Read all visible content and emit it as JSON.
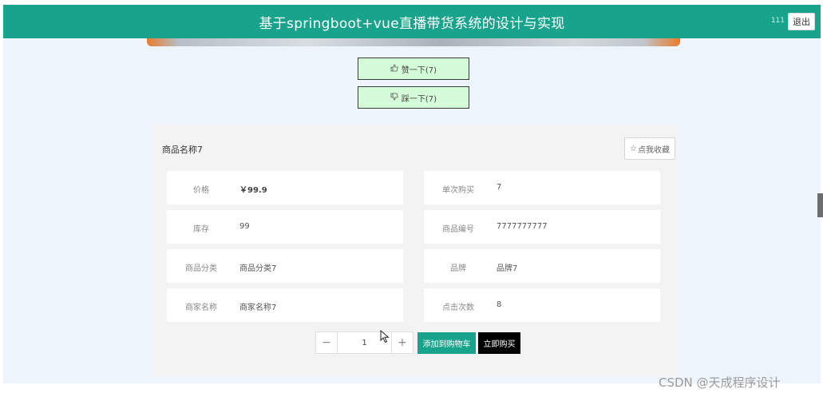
{
  "header": {
    "title": "基于springboot+vue直播带货系统的设计与实现",
    "username": "111",
    "logout_label": "退出",
    "color": "#18a48c"
  },
  "votes": {
    "like_label": "赞一下(7)",
    "dislike_label": "踩一下(7)",
    "like_icon": "thumbs-up-icon",
    "dislike_icon": "thumbs-down-icon"
  },
  "product": {
    "title": "商品名称7",
    "favorite_label": "点我收藏",
    "favorite_icon": "star-icon",
    "fields": [
      {
        "label": "价格",
        "value": "￥99.9"
      },
      {
        "label": "单次购买",
        "value": "7"
      },
      {
        "label": "库存",
        "value": "99"
      },
      {
        "label": "商品编号",
        "value": "7777777777"
      },
      {
        "label": "商品分类",
        "value": "商品分类7"
      },
      {
        "label": "品牌",
        "value": "品牌7"
      },
      {
        "label": "商家名称",
        "value": "商家名称7"
      },
      {
        "label": "点击次数",
        "value": "8"
      }
    ]
  },
  "purchase": {
    "quantity": "1",
    "minus_label": "−",
    "plus_label": "+",
    "add_cart_label": "添加到购物车",
    "buy_now_label": "立即购买"
  },
  "watermark": "CSDN @天成程序设计"
}
